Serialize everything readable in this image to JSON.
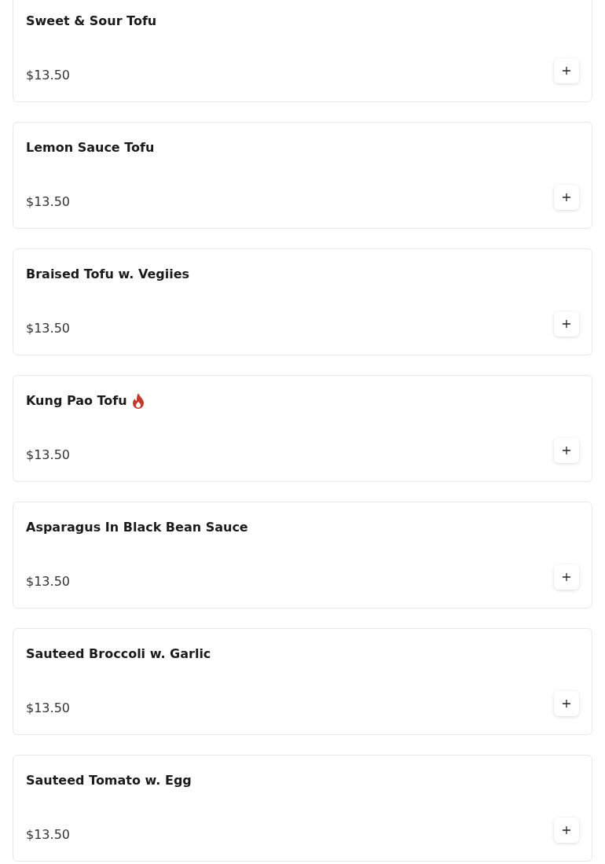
{
  "menu_items": [
    {
      "name": "Sweet & Sour Tofu",
      "spicy": false,
      "price": "$13.50"
    },
    {
      "name": "Lemon Sauce Tofu",
      "spicy": false,
      "price": "$13.50"
    },
    {
      "name": "Braised Tofu w. Vegiies",
      "spicy": false,
      "price": "$13.50"
    },
    {
      "name": "Kung Pao Tofu",
      "spicy": true,
      "price": "$13.50"
    },
    {
      "name": "Asparagus In Black Bean Sauce",
      "spicy": false,
      "price": "$13.50"
    },
    {
      "name": "Sauteed Broccoli w. Garlic",
      "spicy": false,
      "price": "$13.50"
    },
    {
      "name": "Sauteed Tomato w. Egg",
      "spicy": false,
      "price": "$13.50"
    }
  ]
}
